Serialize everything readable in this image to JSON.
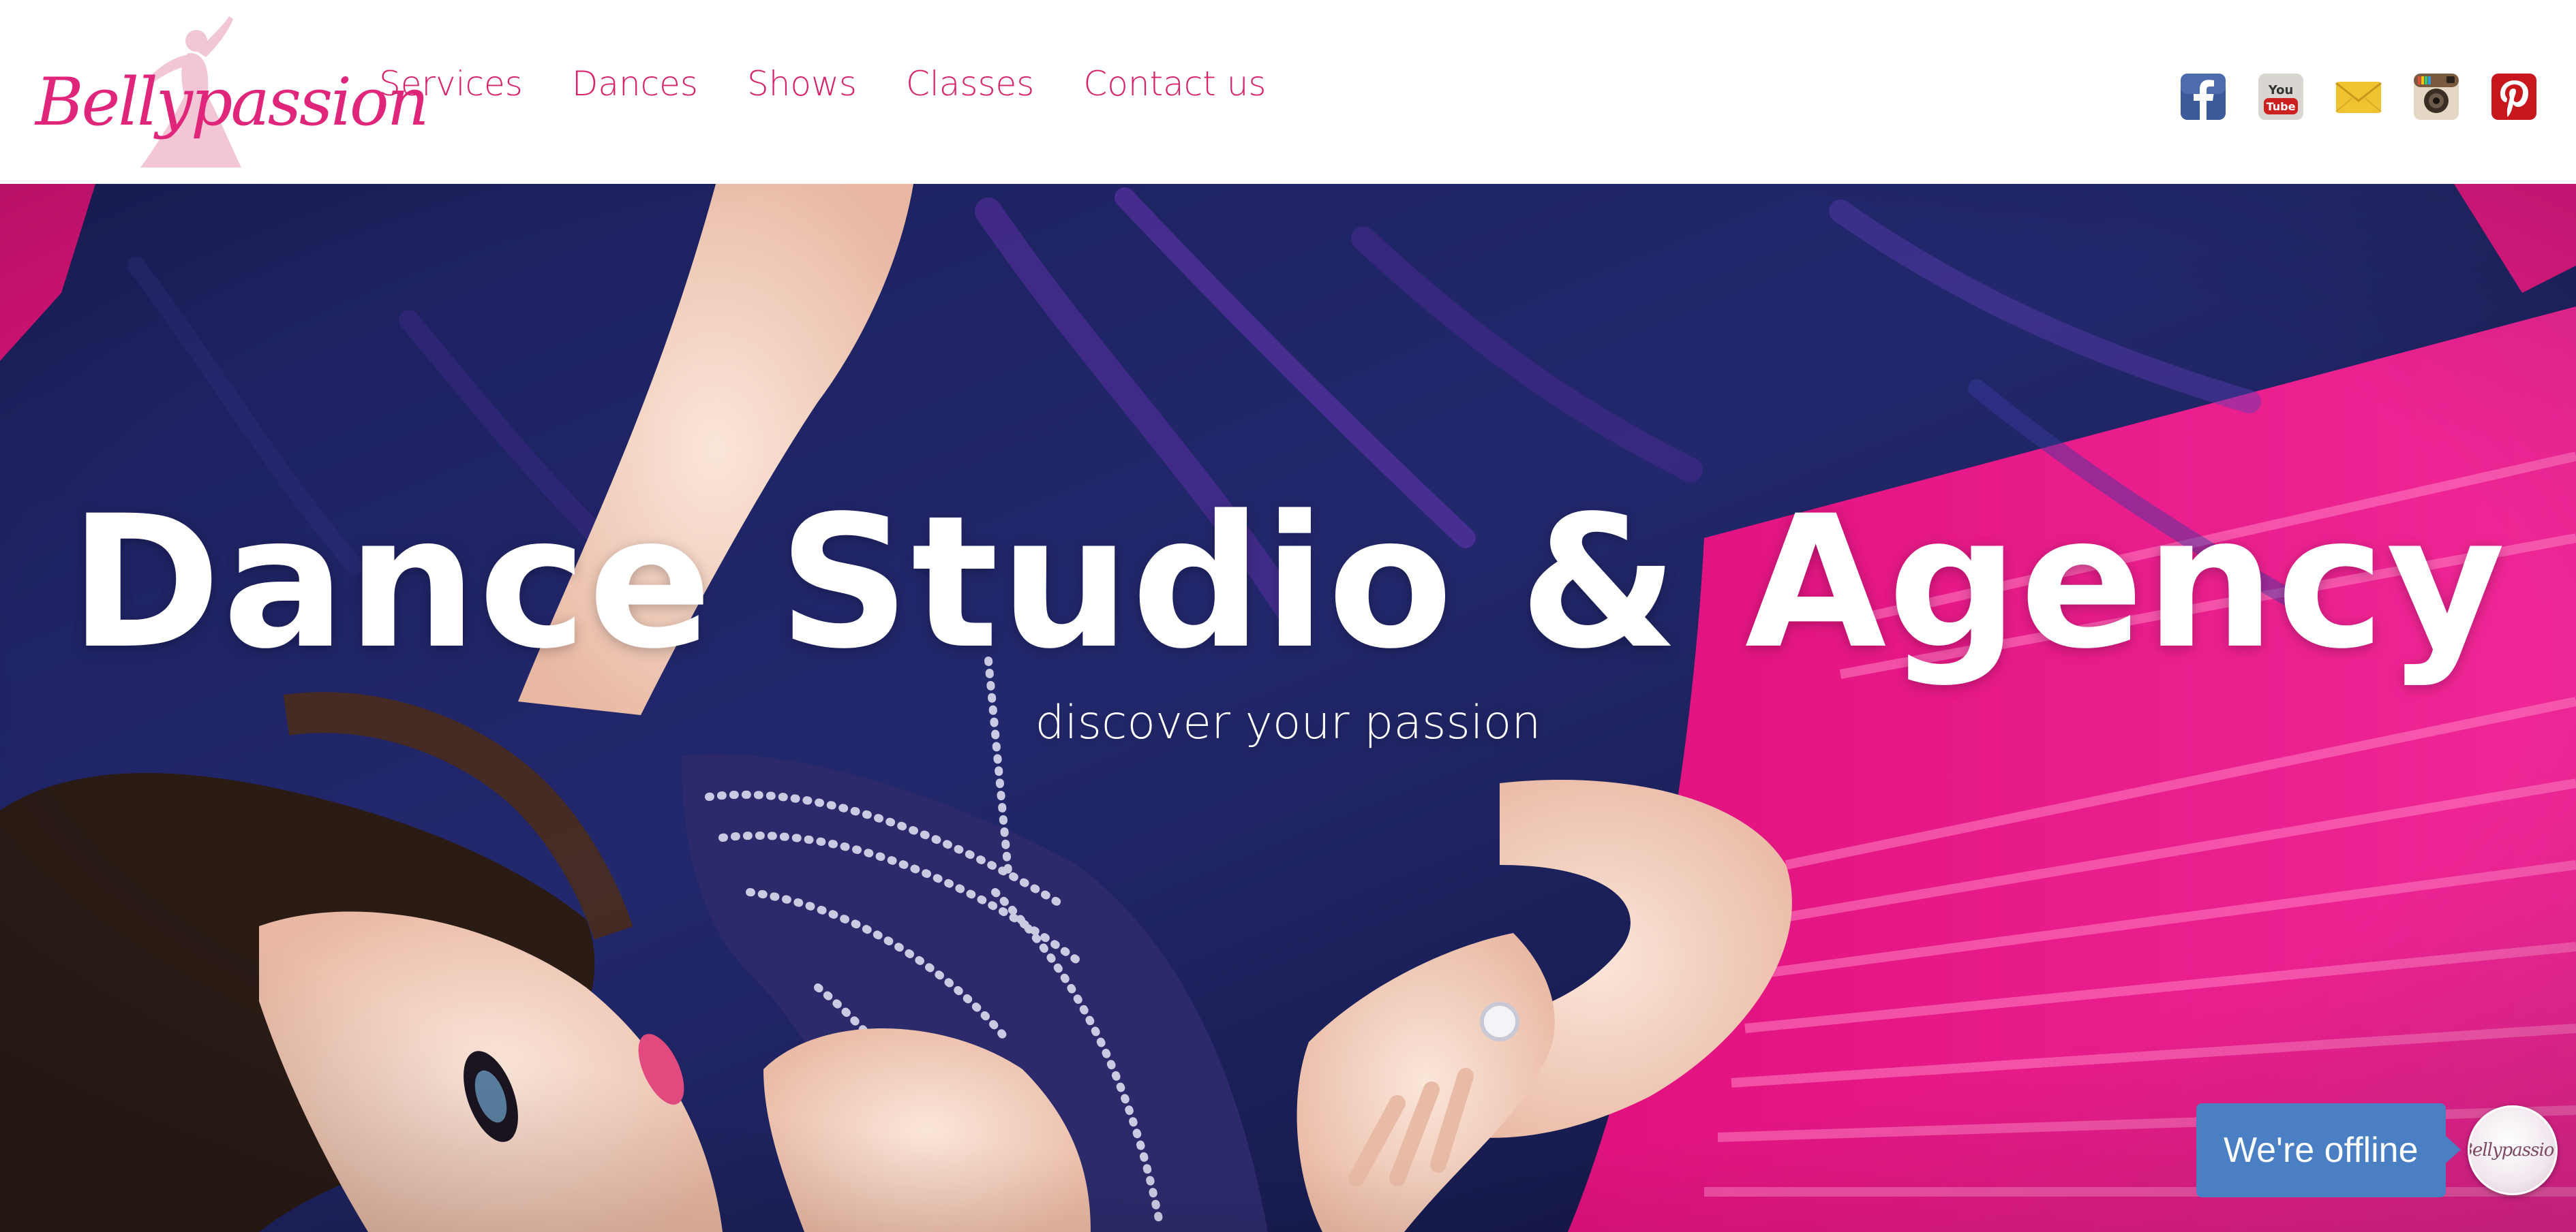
{
  "brand": {
    "name": "Bellypassion",
    "accent_color": "#e0267a"
  },
  "nav": {
    "items": [
      {
        "label": "Services"
      },
      {
        "label": "Dances"
      },
      {
        "label": "Shows"
      },
      {
        "label": "Classes"
      },
      {
        "label": "Contact us"
      }
    ]
  },
  "social": {
    "icons": [
      "facebook-icon",
      "youtube-icon",
      "email-icon",
      "instagram-icon",
      "pinterest-icon"
    ]
  },
  "hero": {
    "title": "Dance Studio & Agency",
    "subtitle": "discover your passion"
  },
  "chat": {
    "status_label": "We're offline",
    "avatar_text": "Bellypassion",
    "button_color": "#4a7fc4"
  }
}
